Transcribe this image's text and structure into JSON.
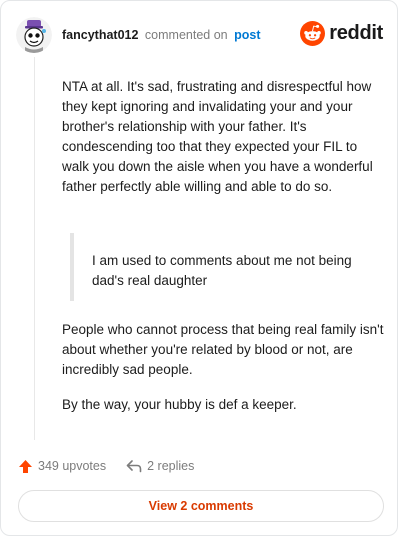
{
  "header": {
    "username": "fancythat012",
    "action_text": "commented on",
    "post_link": "post",
    "brand_name": "reddit"
  },
  "icons": {
    "avatar": "avatar-icon",
    "brand": "reddit-logo-icon",
    "upvote": "upvote-arrow-icon",
    "reply": "reply-arrow-icon"
  },
  "comment": {
    "paragraph1": "NTA at all. It's sad, frustrating and disrespectful how they kept ignoring and invalidating your and your brother's relationship with your father. It's condescending too that they expected your FIL to walk you down the aisle when you have a wonderful father perfectly able willing and able to do so.",
    "quote": "I am used to comments about me not being dad's real daughter",
    "paragraph2": "People who cannot process that being real family isn't about whether you're related by blood or not, are incredibly sad people.",
    "paragraph3": "By the way, your hubby is def a keeper."
  },
  "footer": {
    "upvotes": "349 upvotes",
    "replies": "2 replies",
    "view_comments": "View 2 comments"
  },
  "colors": {
    "brand_orange": "#ff4500",
    "link_blue": "#0079d3",
    "button_text": "#d93a00",
    "muted_text": "#7c7c7c"
  }
}
